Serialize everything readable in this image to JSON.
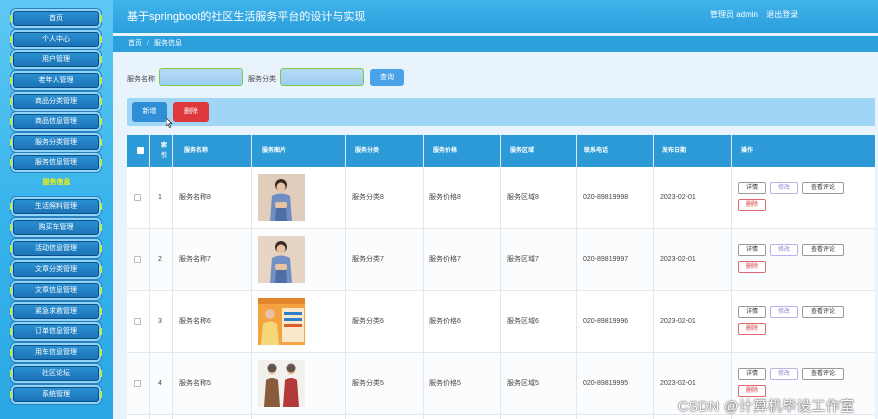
{
  "sidebar": {
    "items": [
      {
        "label": "首页"
      },
      {
        "label": "个人中心"
      },
      {
        "label": "用户管理"
      },
      {
        "label": "老年人管理"
      },
      {
        "label": "商品分类管理"
      },
      {
        "label": "商品信息管理"
      },
      {
        "label": "服务分类管理"
      },
      {
        "label": "服务信息管理"
      },
      {
        "label": "服务信息"
      },
      {
        "label": "生活照料管理"
      },
      {
        "label": "购买车管理"
      },
      {
        "label": "活动信息管理"
      },
      {
        "label": "文章分类管理"
      },
      {
        "label": "文章信息管理"
      },
      {
        "label": "紧急求救管理"
      },
      {
        "label": "订单信息管理"
      },
      {
        "label": "用车信息管理"
      },
      {
        "label": "社区论坛"
      },
      {
        "label": "系统管理"
      }
    ]
  },
  "header": {
    "title": "基于springboot的社区生活服务平台的设计与实现",
    "user_label": "管理员 admin",
    "logout": "退出登录"
  },
  "breadcrumb": {
    "home": "首页",
    "sep": "/",
    "current": "服务信息"
  },
  "search": {
    "name_label": "服务名称",
    "name_value": "",
    "category_label": "服务分类",
    "category_value": "",
    "button": "查询"
  },
  "actions": {
    "add": "新增",
    "delete": "删除"
  },
  "table": {
    "columns": [
      "",
      "索引",
      "服务名称",
      "服务图片",
      "服务分类",
      "服务价格",
      "服务区域",
      "联系电话",
      "发布日期",
      "操作"
    ],
    "rows": [
      {
        "index": "1",
        "name": "服务名称8",
        "category": "服务分类8",
        "price": "服务价格8",
        "area": "服务区域8",
        "phone": "020-89819998",
        "date": "2023-02-01",
        "image": "worker-photo"
      },
      {
        "index": "2",
        "name": "服务名称7",
        "category": "服务分类7",
        "price": "服务价格7",
        "area": "服务区域7",
        "phone": "020-89819997",
        "date": "2023-02-01",
        "image": "worker-photo"
      },
      {
        "index": "3",
        "name": "服务名称6",
        "category": "服务分类6",
        "price": "服务价格6",
        "area": "服务区域6",
        "phone": "020-89819996",
        "date": "2023-02-01",
        "image": "poster-photo"
      },
      {
        "index": "4",
        "name": "服务名称5",
        "category": "服务分类5",
        "price": "服务价格5",
        "area": "服务区域5",
        "phone": "020-89819995",
        "date": "2023-02-01",
        "image": "staff-photo"
      }
    ],
    "ops": {
      "detail": "详情",
      "edit": "修改",
      "comments": "查看评论",
      "delete": "删除"
    }
  },
  "watermark": "CSDN @计算机毕设工作室",
  "colors": {
    "sidebar": "#38b4ec",
    "header": "#2c9fdd",
    "menu_button": "#1d74b8",
    "active_menu_text": "#f6f200",
    "delete": "#e0373c"
  }
}
